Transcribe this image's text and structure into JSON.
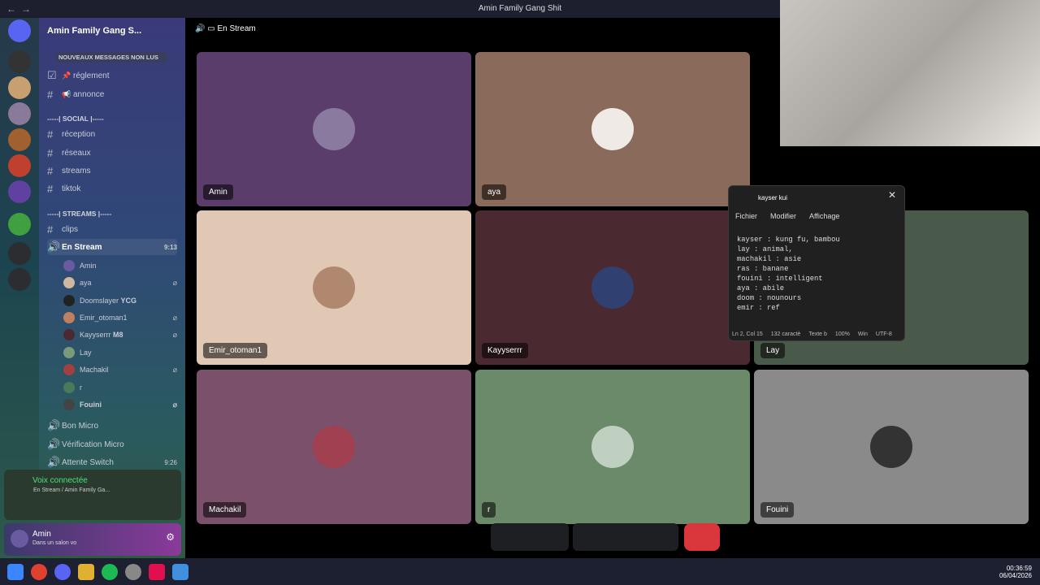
{
  "window_title": "Amin Family Gang Shit",
  "guild": {
    "name": "Amin Family Gang S...",
    "new_msgs": "NOUVEAUX MESSAGES NON LUS"
  },
  "channels": [
    {
      "name": "réglement"
    },
    {
      "name": "annonce"
    }
  ],
  "cat_social": "-----| SOCIAL |-----",
  "social": [
    {
      "name": "réception"
    },
    {
      "name": "réseaux"
    },
    {
      "name": "streams"
    },
    {
      "name": "tiktok"
    }
  ],
  "cat_streams": "-----| STREAMS |-----",
  "streams_ch": [
    {
      "name": "clips"
    }
  ],
  "voice_active": {
    "name": "En Stream",
    "time": "9:13"
  },
  "voice_users": [
    {
      "name": "Amin",
      "badge": ""
    },
    {
      "name": "aya",
      "badge": ""
    },
    {
      "name": "Doomslayer",
      "badge": "YCG"
    },
    {
      "name": "Emir_otoman1",
      "badge": ""
    },
    {
      "name": "Kayyserrr",
      "badge": "M8"
    },
    {
      "name": "Lay",
      "badge": ""
    },
    {
      "name": "Machakil",
      "badge": ""
    },
    {
      "name": "r",
      "badge": ""
    },
    {
      "name": "Fouini",
      "badge": ""
    }
  ],
  "other_voice": [
    {
      "name": "Bon Micro"
    },
    {
      "name": "Vérification Micro"
    },
    {
      "name": "Attente Switch",
      "time": "9:26"
    }
  ],
  "voice_panel": {
    "status": "Voix connectée",
    "location": "En Stream / Amin Family Ga..."
  },
  "user_panel": {
    "name": "Amin",
    "status": "Dans un salon vo"
  },
  "stage_header": "En Stream",
  "tiles": [
    {
      "label": "Amin",
      "color": "#5a3d6a"
    },
    {
      "label": "aya",
      "color": "#8a6a5a"
    },
    {
      "label": "Emir_otoman1",
      "color": "#e0c8b4"
    },
    {
      "label": "Kayyserrr",
      "color": "#4a2a30"
    },
    {
      "label": "Lay",
      "color": "#4a5a4a"
    },
    {
      "label": "Machakil",
      "color": "#7a506a"
    },
    {
      "label": "r",
      "color": "#6a8a6a"
    },
    {
      "label": "Fouini",
      "color": "#8a8a8a"
    }
  ],
  "notepad": {
    "tab": "kayser  kui",
    "menus": [
      "Fichier",
      "Modifier",
      "Affichage"
    ],
    "content": "kayser : kung fu, bambou\nlay : animal,\nmachakil : asie\nras : banane\nfouini : intelligent\naya : abile\ndoom : nounours\nemir : ref",
    "status": [
      "Ln 2, Col 15",
      "132 caractè",
      "Texte b",
      "100%",
      "Win",
      "UTF-8"
    ]
  },
  "clock": {
    "time": "00:36:59",
    "date": "06/04/2026"
  }
}
